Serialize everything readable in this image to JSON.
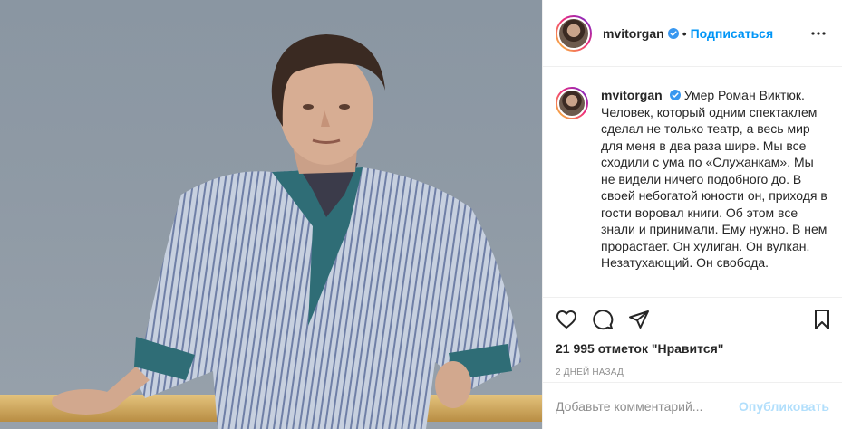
{
  "post": {
    "username": "mvitorgan",
    "follow_label": "Подписаться",
    "caption": "Умер Роман Виктюк. Человек, который одним спектаклем сделал не только театр, а весь мир для меня в два раза шире. Мы все сходили с ума по «Служанкам». Мы не видели ничего подобного до. В своей небогатой юности он, приходя в гости воровал книги. Об этом все знали и принимали. Ему нужно. В нем прорастает. Он хулиган. Он вулкан. Незатухающий. Он свобода.",
    "likes": "21 995 отметок \"Нравится\"",
    "date": "2 ДНЕЙ НАЗАД"
  },
  "comment": {
    "placeholder": "Добавьте комментарий...",
    "publish_label": "Опубликовать"
  },
  "icons": {
    "verified": "verified-badge-icon",
    "more": "more-options-icon",
    "like": "heart-icon",
    "comment": "comment-icon",
    "share": "share-icon",
    "save": "bookmark-icon"
  },
  "colors": {
    "accent": "#0095f6",
    "publish_disabled": "#b2dffc",
    "meta_gray": "#8e8e8e",
    "border": "#efefef"
  }
}
